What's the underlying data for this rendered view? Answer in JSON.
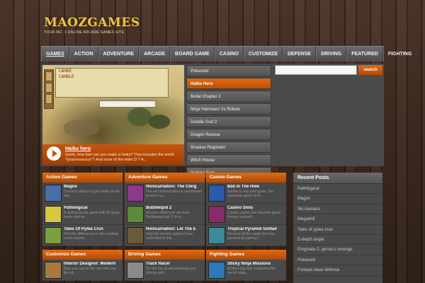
{
  "header": {
    "logo_text": "MAOZGAMES",
    "tagline": "Your No. 1 Online Arcade Games Site"
  },
  "nav": {
    "items": [
      "GAMES",
      "ACTION",
      "ADVENTURE",
      "ARCADE",
      "BOARD GAME",
      "CASINO",
      "CUSTOMIZE",
      "DEFENSE",
      "DRIVING",
      "FEATURED",
      "FIGHTING"
    ]
  },
  "featured": {
    "panel_lines": [
      "CAHDE",
      "CAHDLE"
    ],
    "caption_title": "Haiku hero",
    "caption_desc": "Quick, how fast can you make a haiku? That includes the world \"tyrannosaurus\"? And none of the letter D ? A...",
    "list": [
      "Pokanoid",
      "Haiku Hero",
      "Belial Chapter 2",
      "Ninja Hamsters Vs Robots",
      "Doodle God 2",
      "Dragon Rescue",
      "Shadow Regiment",
      "Witch House",
      "Parking Fast"
    ],
    "active_index": 1
  },
  "search": {
    "placeholder": "",
    "button_label": "search"
  },
  "categories": {
    "action": {
      "title": "Action Games",
      "games": [
        {
          "title": "Magnx",
          "desc": "Connect objects to get smiley to the exit...",
          "color": "#4a6fa8"
        },
        {
          "title": "Pathilogical",
          "desc": "A sliding puzzle game with 40 great levels and an...",
          "color": "#d8c840"
        },
        {
          "title": "Tales Of Pylea Crux",
          "desc": "Find the differences in this exciting comic-based...",
          "color": "#7aa040"
        }
      ]
    },
    "adventure": {
      "title": "Adventure Games",
      "games": [
        {
          "title": "Reincarnation: The Clerg",
          "desc": "The evil reincarnation is summoned to reel in a...",
          "color": "#8a3a8a"
        },
        {
          "title": "Bubbleqod 2",
          "desc": "All your references are from Bubbleqod part 1! In a...",
          "color": "#5a8a3a"
        },
        {
          "title": "Reincarnation: Let The E",
          "desc": "Help the demon capture three souls!And in this...",
          "color": "#6a5a3a"
        }
      ]
    },
    "casino": {
      "title": "Casino Games",
      "games": [
        {
          "title": "Ball In The Hole",
          "desc": "Similar to any pool game, the awesome game by ki...",
          "color": "#2a5aa8"
        },
        {
          "title": "Casino Slots",
          "desc": "Classic casino slot machine game. Amaze yourself...",
          "color": "#8a2a6a"
        },
        {
          "title": "Tropical Pyramid Solitair",
          "desc": "Remove all the cards from the pyramid by pairing t...",
          "color": "#3a8a9a"
        }
      ]
    },
    "customize": {
      "title": "Customize Games",
      "games": [
        {
          "title": "Interior Designer: Modern",
          "desc": "Now you can be the one who you like all ...",
          "color": "#a87a40"
        }
      ]
    },
    "driving": {
      "title": "Driving Games",
      "games": [
        {
          "title": "Track Racer",
          "desc": "Try the fun all about testing your driving skill...",
          "color": "#8a8a8a"
        }
      ]
    },
    "fighting": {
      "title": "Fighting Games",
      "games": [
        {
          "title": "Sticky Ninja Missions",
          "desc": "All the ninja has completed the secret ninja...",
          "color": "#2a7ab8"
        }
      ]
    }
  },
  "recent_posts": {
    "title": "Recent Posts",
    "items": [
      "Pathilogical",
      "Magnx",
      "Ski maniacs",
      "Megadrill",
      "Tales of pylea crux",
      "E-depth angel",
      "Enigmata 2: genus's revenge",
      "Pokanoid",
      "Fureyes base defense"
    ]
  }
}
